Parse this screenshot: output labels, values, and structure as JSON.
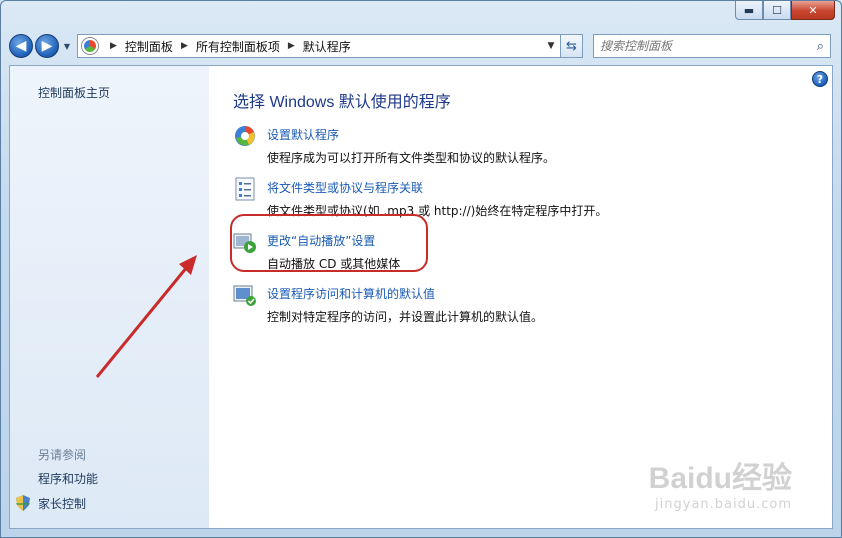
{
  "window": {
    "controls": {
      "minimize": "▬",
      "maximize": "☐",
      "close": "✕"
    }
  },
  "nav": {
    "back_glyph": "◀",
    "forward_glyph": "▶",
    "breadcrumb": [
      "控制面板",
      "所有控制面板项",
      "默认程序"
    ],
    "search_placeholder": "搜索控制面板"
  },
  "sidebar": {
    "home": "控制面板主页",
    "see_also_heading": "另请参阅",
    "see_also_links": [
      "程序和功能",
      "家长控制"
    ]
  },
  "main": {
    "title": "选择 Windows 默认使用的程序",
    "tasks": [
      {
        "link": "设置默认程序",
        "desc": "使程序成为可以打开所有文件类型和协议的默认程序。",
        "icon": "default-programs-icon"
      },
      {
        "link": "将文件类型或协议与程序关联",
        "desc": "使文件类型或协议(如 .mp3 或 http://)始终在特定程序中打开。",
        "icon": "file-association-icon"
      },
      {
        "link": "更改“自动播放”设置",
        "desc": "自动播放 CD 或其他媒体",
        "icon": "autoplay-icon"
      },
      {
        "link": "设置程序访问和计算机的默认值",
        "desc": "控制对特定程序的访问，并设置此计算机的默认值。",
        "icon": "program-access-icon"
      }
    ]
  },
  "watermark": {
    "main": "Baidu经验",
    "sub": "jingyan.baidu.com"
  },
  "colors": {
    "link": "#1a5bb6",
    "title": "#1e3a8a",
    "annotation": "#c92b2b"
  }
}
